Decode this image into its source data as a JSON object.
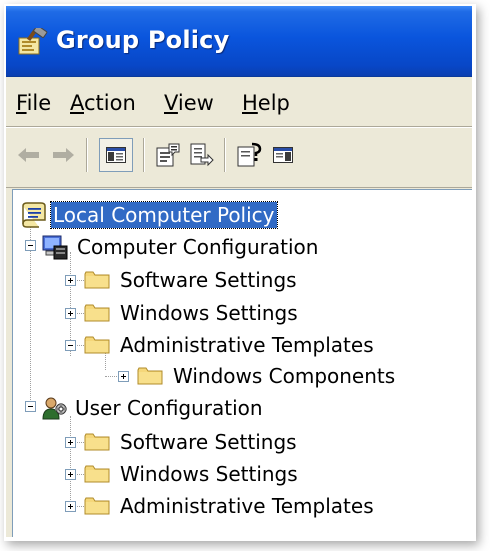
{
  "window": {
    "title": "Group Policy",
    "icon": "group-policy-icon"
  },
  "menubar": {
    "items": [
      {
        "first": "F",
        "rest": "ile"
      },
      {
        "first": "A",
        "rest": "ction"
      },
      {
        "first": "V",
        "rest": "iew"
      },
      {
        "first": "H",
        "rest": "elp"
      }
    ]
  },
  "toolbar": {
    "buttons": [
      "back-arrow-icon",
      "forward-arrow-icon",
      "show-hide-tree-icon",
      "properties-icon",
      "export-list-icon",
      "help-icon",
      "show-hide-action-pane-icon"
    ]
  },
  "tree": {
    "root": {
      "label": "Local Computer Policy",
      "icon": "policy-scroll-icon",
      "selected": true
    },
    "computer": {
      "label": "Computer Configuration",
      "icon": "computer-config-icon",
      "children": {
        "software": "Software Settings",
        "windows": "Windows Settings",
        "admin": "Administrative Templates",
        "components": "Windows Components"
      }
    },
    "user": {
      "label": "User Configuration",
      "icon": "user-config-icon",
      "children": {
        "software": "Software Settings",
        "windows": "Windows Settings",
        "admin": "Administrative Templates"
      }
    }
  },
  "colors": {
    "titlebar": "#0a55dd",
    "selection": "#316AC5",
    "chrome": "#ECE9D8",
    "folder": "#F5D77A"
  }
}
